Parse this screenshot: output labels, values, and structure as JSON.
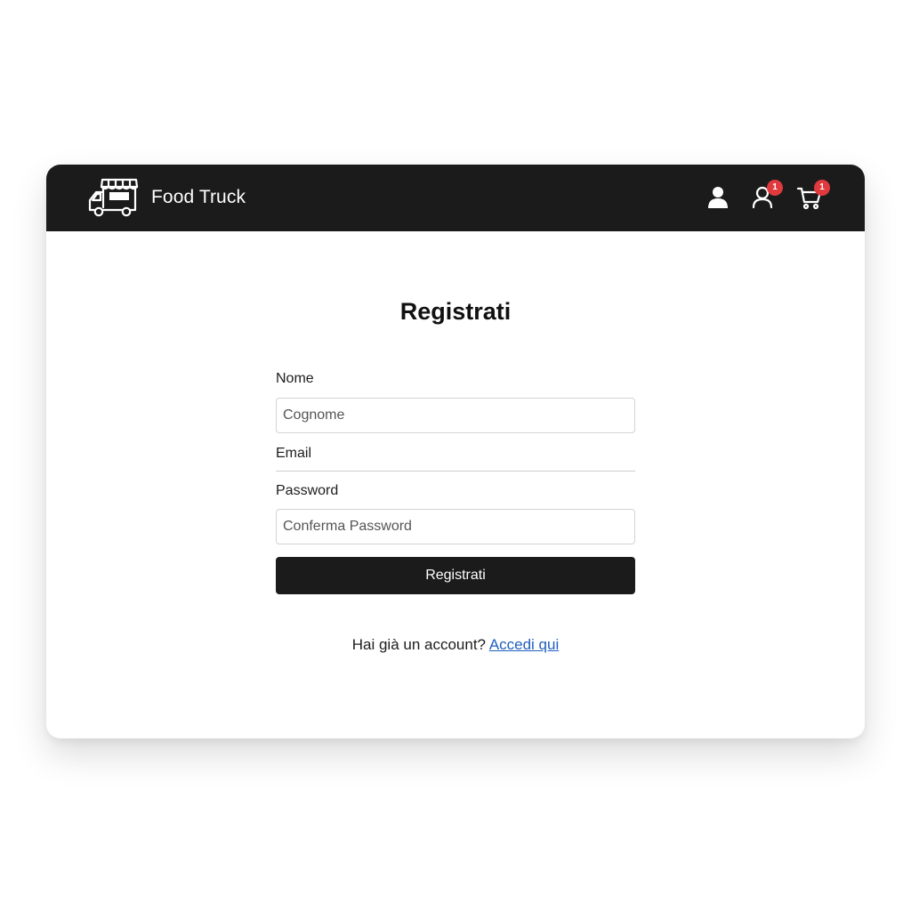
{
  "header": {
    "brand_name": "Food Truck",
    "brand_icon": "food-truck-icon",
    "icons": [
      "user-icon",
      "account-icon",
      "cart-icon"
    ],
    "account_badge": "1",
    "cart_badge": "1",
    "badge_color": "#e03a3e",
    "background_color": "#1b1b1b"
  },
  "form": {
    "title": "Registrati",
    "name_label": "Nome",
    "surname_placeholder": "Cognome",
    "email_label": "Email",
    "password_label": "Password",
    "confirm_password_placeholder": "Conferma Password",
    "submit_label": "Registrati"
  },
  "footer": {
    "prompt": "Hai già un account?",
    "link_label": "Accedi qui",
    "link_color": "#1f5fbf"
  }
}
